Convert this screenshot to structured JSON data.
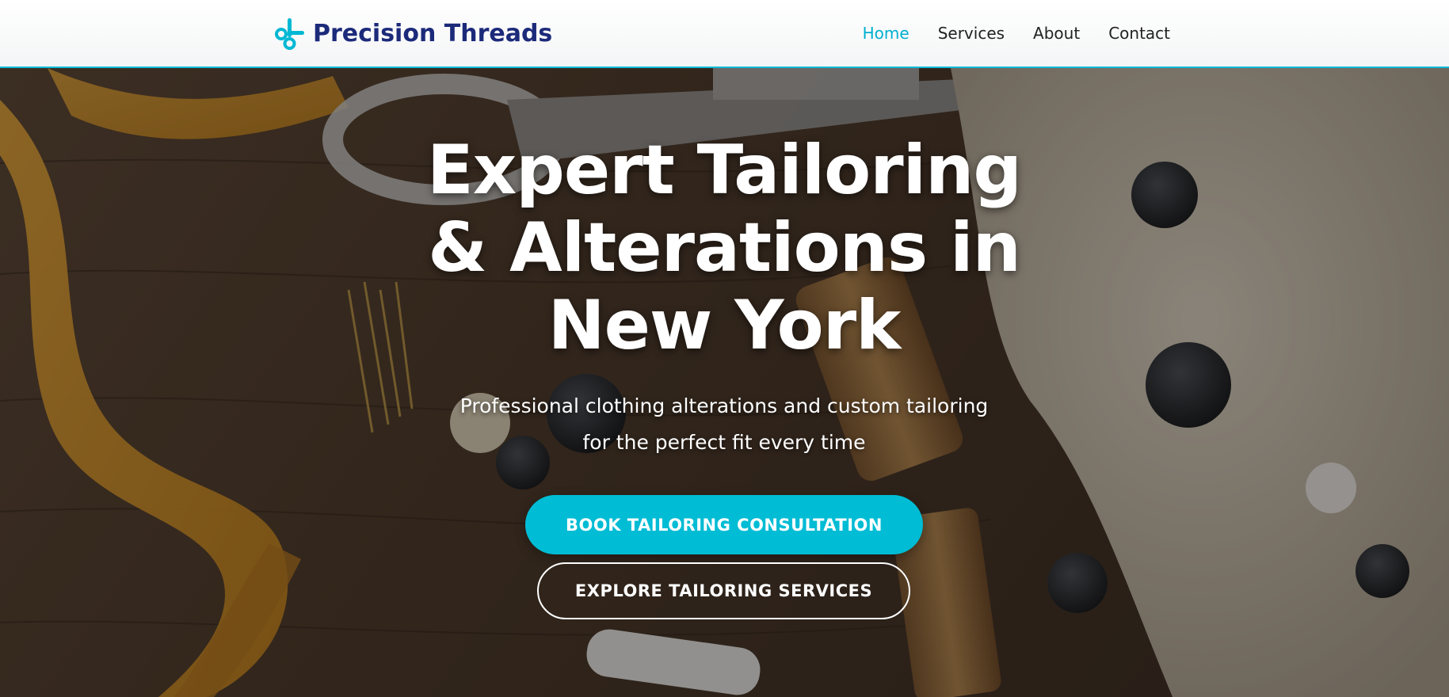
{
  "brand": {
    "name": "Precision Threads",
    "icon": "scissors-icon",
    "color": "#1c2a7a"
  },
  "nav": {
    "items": [
      {
        "label": "Home",
        "active": true
      },
      {
        "label": "Services",
        "active": false
      },
      {
        "label": "About",
        "active": false
      },
      {
        "label": "Contact",
        "active": false
      }
    ]
  },
  "hero": {
    "title_lines": [
      "Expert Tailoring",
      "& Alterations in",
      "New York"
    ],
    "subtitle_lines": [
      "Professional clothing alterations and custom tailoring",
      "for the perfect fit every time"
    ],
    "primary_cta": "BOOK TAILORING CONSULTATION",
    "secondary_cta": "EXPLORE TAILORING SERVICES",
    "background": "tailoring-tools-photo"
  },
  "colors": {
    "accent": "#00bcd4",
    "brand_text": "#1c2a7a",
    "nav_active": "#00b0d0"
  }
}
